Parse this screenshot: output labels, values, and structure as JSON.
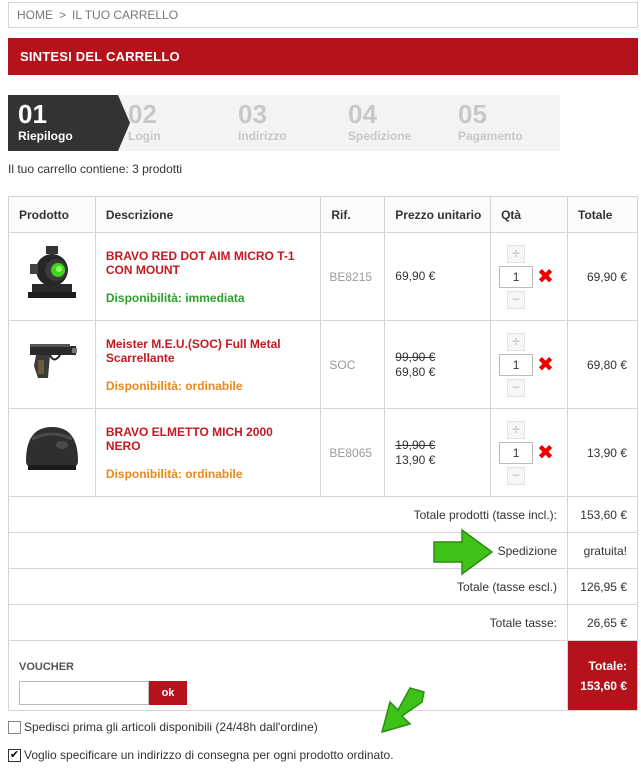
{
  "breadcrumb": {
    "home": "HOME",
    "separator": ">",
    "current": "IL TUO CARRELLO"
  },
  "page_title": "SINTESI DEL CARRELLO",
  "steps": [
    {
      "num": "01",
      "label": "Riepilogo"
    },
    {
      "num": "02",
      "label": "Login"
    },
    {
      "num": "03",
      "label": "Indirizzo"
    },
    {
      "num": "04",
      "label": "Spedizione"
    },
    {
      "num": "05",
      "label": "Pagamento"
    }
  ],
  "cart_summary": "Il tuo carrello contiene: 3 prodotti",
  "table": {
    "headers": {
      "product": "Prodotto",
      "description": "Descrizione",
      "ref": "Rif.",
      "unit_price": "Prezzo unitario",
      "qty": "Qtà",
      "total": "Totale"
    },
    "rows": [
      {
        "name": "BRAVO RED DOT AIM MICRO T-1 CON MOUNT",
        "availability": "Disponibilità: immediata",
        "ref": "BE8215",
        "old_price": "",
        "price": "69,90 €",
        "qty": "1",
        "total": "69,90 €"
      },
      {
        "name": "Meister M.E.U.(SOC) Full Metal Scarrellante",
        "availability": "Disponibilità: ordinabile",
        "ref": "SOC",
        "old_price": "99,90 €",
        "price": "69,80 €",
        "qty": "1",
        "total": "69,80 €"
      },
      {
        "name": "BRAVO ELMETTO MICH 2000 NERO",
        "availability": "Disponibilità: ordinabile",
        "ref": "BE8065",
        "old_price": "19,90 €",
        "price": "13,90 €",
        "qty": "1",
        "total": "13,90 €"
      }
    ],
    "qty_plus": "+",
    "qty_minus": "−",
    "delete_glyph": "✖"
  },
  "summary": {
    "products_label": "Totale prodotti (tasse incl.):",
    "products_value": "153,60 €",
    "shipping_label": "Spedizione",
    "shipping_value": "gratuita!",
    "excl_label": "Totale (tasse escl.)",
    "excl_value": "126,95 €",
    "tax_label": "Totale tasse:",
    "tax_value": "26,65 €"
  },
  "voucher": {
    "title": "VOUCHER",
    "button": "ok",
    "placeholder": ""
  },
  "grand_total": {
    "label": "Totale:",
    "value": "153,60 €"
  },
  "options": {
    "ship_available": "Spedisci prima gli articoli disponibili (24/48h dall'ordine)",
    "ship_available_checked": false,
    "multi_address": "Voglio specificare un indirizzo di consegna per ogni prodotto ordinato.",
    "multi_address_checked": true,
    "check_glyph": "✔"
  },
  "colors": {
    "brand_red": "#b5121b",
    "available_green": "#2ca02c",
    "orderable_orange": "#e8891a",
    "arrow_green": "#3ec21a"
  }
}
